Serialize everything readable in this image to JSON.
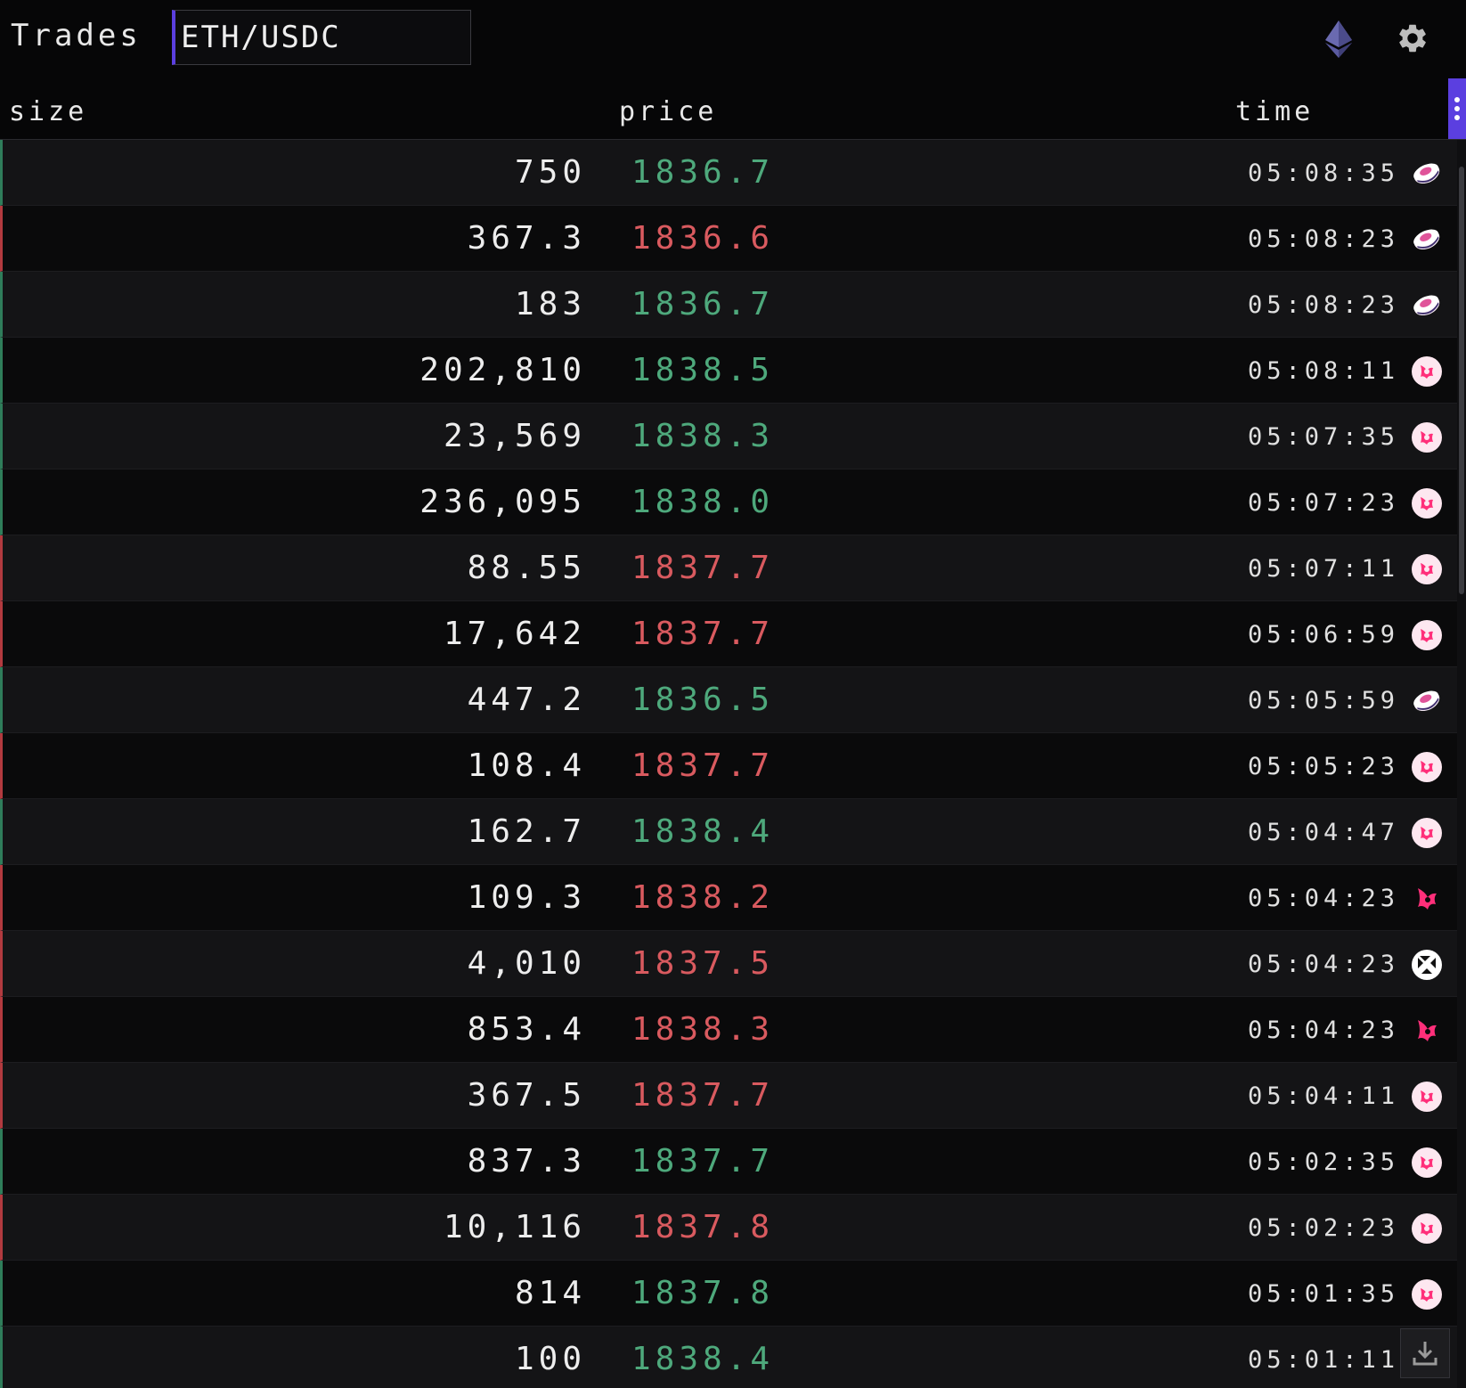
{
  "header": {
    "title": "Trades",
    "symbol_value": "ETH/USDC",
    "chain_icon": "ethereum-icon",
    "settings_icon": "gear-icon"
  },
  "columns": {
    "size": "size",
    "price": "price",
    "time": "time"
  },
  "colors": {
    "buy": "#4ea97c",
    "sell": "#d95a5f",
    "accent": "#5b3fe0",
    "sushiswap": "#e05a9b",
    "uniswap": "#ff2f7a"
  },
  "trades": [
    {
      "size": "750",
      "price": "1836.7",
      "side": "buy",
      "time": "05:08:35",
      "venue": "sushiswap"
    },
    {
      "size": "367.3",
      "price": "1836.6",
      "side": "sell",
      "time": "05:08:23",
      "venue": "sushiswap"
    },
    {
      "size": "183",
      "price": "1836.7",
      "side": "buy",
      "time": "05:08:23",
      "venue": "sushiswap"
    },
    {
      "size": "202,810",
      "price": "1838.5",
      "side": "buy",
      "time": "05:08:11",
      "venue": "uniswap-v3"
    },
    {
      "size": "23,569",
      "price": "1838.3",
      "side": "buy",
      "time": "05:07:35",
      "venue": "uniswap-v3"
    },
    {
      "size": "236,095",
      "price": "1838.0",
      "side": "buy",
      "time": "05:07:23",
      "venue": "uniswap-v3"
    },
    {
      "size": "88.55",
      "price": "1837.7",
      "side": "sell",
      "time": "05:07:11",
      "venue": "uniswap-v3"
    },
    {
      "size": "17,642",
      "price": "1837.7",
      "side": "sell",
      "time": "05:06:59",
      "venue": "uniswap-v3"
    },
    {
      "size": "447.2",
      "price": "1836.5",
      "side": "buy",
      "time": "05:05:59",
      "venue": "sushiswap"
    },
    {
      "size": "108.4",
      "price": "1837.7",
      "side": "sell",
      "time": "05:05:23",
      "venue": "uniswap-v3"
    },
    {
      "size": "162.7",
      "price": "1838.4",
      "side": "buy",
      "time": "05:04:47",
      "venue": "uniswap-v3"
    },
    {
      "size": "109.3",
      "price": "1838.2",
      "side": "sell",
      "time": "05:04:23",
      "venue": "uniswap-v2"
    },
    {
      "size": "4,010",
      "price": "1837.5",
      "side": "sell",
      "time": "05:04:23",
      "venue": "0x"
    },
    {
      "size": "853.4",
      "price": "1838.3",
      "side": "sell",
      "time": "05:04:23",
      "venue": "uniswap-v2"
    },
    {
      "size": "367.5",
      "price": "1837.7",
      "side": "sell",
      "time": "05:04:11",
      "venue": "uniswap-v3"
    },
    {
      "size": "837.3",
      "price": "1837.7",
      "side": "buy",
      "time": "05:02:35",
      "venue": "uniswap-v3"
    },
    {
      "size": "10,116",
      "price": "1837.8",
      "side": "sell",
      "time": "05:02:23",
      "venue": "uniswap-v3"
    },
    {
      "size": "814",
      "price": "1837.8",
      "side": "buy",
      "time": "05:01:35",
      "venue": "uniswap-v3"
    },
    {
      "size": "100",
      "price": "1838.4",
      "side": "buy",
      "time": "05:01:11",
      "venue": "uniswap-v3"
    }
  ]
}
